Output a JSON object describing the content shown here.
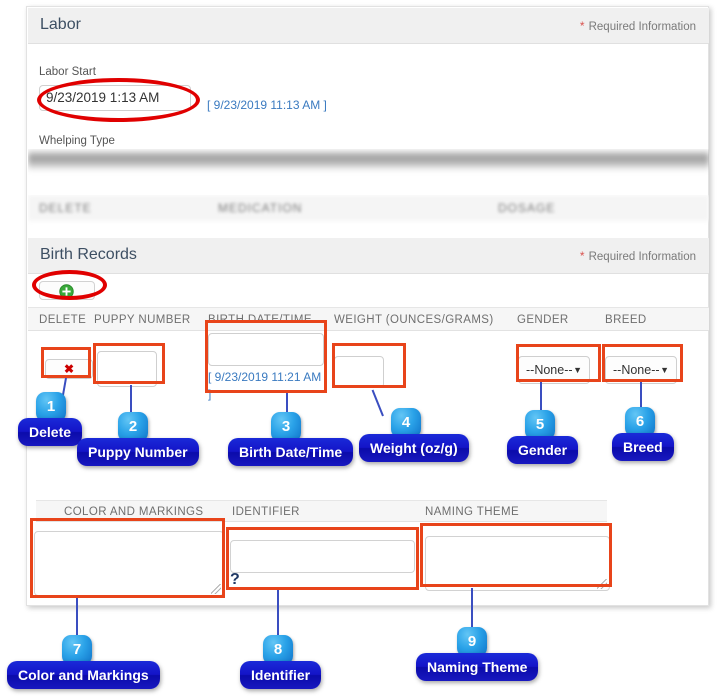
{
  "sections": [
    {
      "title": "Labor",
      "required_note": "Required Information",
      "required_star": "*"
    },
    {
      "title": "Birth Records",
      "required_note": "Required Information",
      "required_star": "*"
    }
  ],
  "labor": {
    "labor_start_label": "Labor Start",
    "labor_start_value": "9/23/2019 1:13 AM",
    "labor_start_hint": "[ 9/23/2019 11:13 AM ]",
    "whelping_type_label": "Whelping Type",
    "obscured_columns": [
      "DELETE",
      "MEDICATION",
      "DOSAGE"
    ]
  },
  "birth_records": {
    "add_button_icon": "plus-icon",
    "columns": [
      "DELETE",
      "PUPPY NUMBER",
      "BIRTH DATE/TIME",
      "WEIGHT (OUNCES/GRAMS)",
      "GENDER",
      "BREED"
    ],
    "row": {
      "delete_label": "✖",
      "puppy_number": "",
      "birth_datetime": "",
      "birth_datetime_hint": "[ 9/23/2019 11:21 AM ]",
      "weight": "",
      "gender": "--None--",
      "breed": "--None--",
      "select_caret": "▼"
    },
    "columns2": [
      "COLOR AND MARKINGS",
      "IDENTIFIER",
      "NAMING THEME"
    ],
    "row2": {
      "color_and_markings": "",
      "identifier": "",
      "identifier_help": "?",
      "naming_theme": ""
    }
  },
  "callouts": [
    {
      "number": "1",
      "label": "Delete"
    },
    {
      "number": "2",
      "label": "Puppy Number"
    },
    {
      "number": "3",
      "label": "Birth Date/Time"
    },
    {
      "number": "4",
      "label": "Weight (oz/g)"
    },
    {
      "number": "5",
      "label": "Gender"
    },
    {
      "number": "6",
      "label": "Breed"
    },
    {
      "number": "7",
      "label": "Color and Markings"
    },
    {
      "number": "8",
      "label": "Identifier"
    },
    {
      "number": "9",
      "label": "Naming Theme"
    }
  ],
  "colors": {
    "highlight": "#e8441a",
    "ellipse": "#e00000",
    "callout_badge": "#1f8fe0",
    "callout_label": "#1414c8",
    "section_header_bg": "#f0f0f0",
    "required_star": "#d9534f",
    "hint_text": "#3a7ac0"
  }
}
